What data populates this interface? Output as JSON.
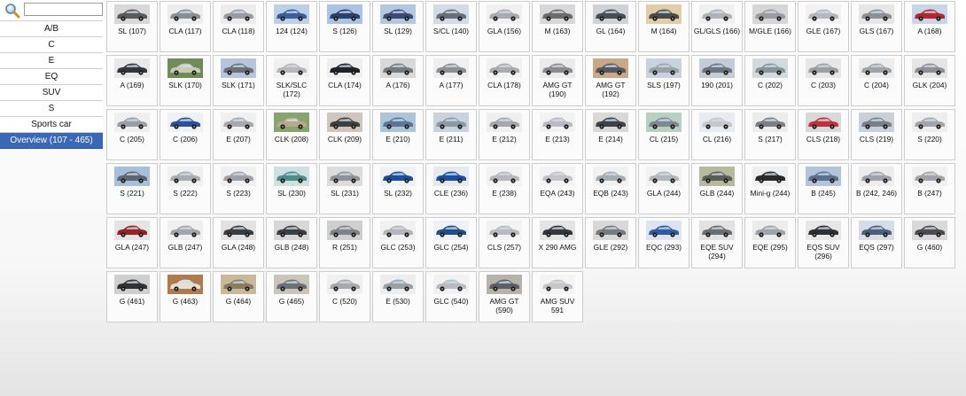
{
  "search": {
    "value": "",
    "placeholder": ""
  },
  "sidebar": {
    "items": [
      {
        "label": "A/B"
      },
      {
        "label": "C"
      },
      {
        "label": "E"
      },
      {
        "label": "EQ"
      },
      {
        "label": "SUV"
      },
      {
        "label": "S"
      },
      {
        "label": "Sports car"
      },
      {
        "label": "Overview (107 - 465)",
        "active": true
      }
    ]
  },
  "models": [
    {
      "label": "SL (107)",
      "color": "#5a5a5a",
      "bg": "#d8d8d8"
    },
    {
      "label": "CLA (117)",
      "color": "#8a8d92",
      "bg": "#ececec"
    },
    {
      "label": "CLA (118)",
      "color": "#9a9ca0",
      "bg": "#ececec"
    },
    {
      "label": "124 (124)",
      "color": "#3b5d9c",
      "bg": "#bcd0e8"
    },
    {
      "label": "S (126)",
      "color": "#2c3e6e",
      "bg": "#a9c3e0"
    },
    {
      "label": "SL (129)",
      "color": "#3a4a78",
      "bg": "#b3c7df"
    },
    {
      "label": "S/CL (140)",
      "color": "#6a6f78",
      "bg": "#d3dbe6"
    },
    {
      "label": "GLA (156)",
      "color": "#a8aaae",
      "bg": "#f0f0f0"
    },
    {
      "label": "M (163)",
      "color": "#6b6b6b",
      "bg": "#d8d8d8"
    },
    {
      "label": "GL (164)",
      "color": "#4a4e54",
      "bg": "#cfd2d6"
    },
    {
      "label": "M (164)",
      "color": "#4b4b4b",
      "bg": "#e0cfa6"
    },
    {
      "label": "GL/GLS (166)",
      "color": "#b0b2b5",
      "bg": "#f0f0f0"
    },
    {
      "label": "M/GLE (166)",
      "color": "#9a9c9f",
      "bg": "#d6d6d6"
    },
    {
      "label": "GLE (167)",
      "color": "#b5b7ba",
      "bg": "#f2f2f2"
    },
    {
      "label": "GLS (167)",
      "color": "#8e9094",
      "bg": "#e6e6e6"
    },
    {
      "label": "A (168)",
      "color": "#b5262a",
      "bg": "#c9d6ea"
    },
    {
      "label": "A (169)",
      "color": "#33363a",
      "bg": "#e9e9e9"
    },
    {
      "label": "SLK (170)",
      "color": "#c9c9b6",
      "bg": "#6f8b5a"
    },
    {
      "label": "SLK (171)",
      "color": "#6a6f7a",
      "bg": "#b7c4dd"
    },
    {
      "label": "SLK/SLC (172)",
      "color": "#b6b8bb",
      "bg": "#f1f1f1"
    },
    {
      "label": "CLA (174)",
      "color": "#1f2226",
      "bg": "#efefef"
    },
    {
      "label": "A (176)",
      "color": "#777a7e",
      "bg": "#d9d9d9"
    },
    {
      "label": "A (177)",
      "color": "#8c8f93",
      "bg": "#efefef"
    },
    {
      "label": "CLA (178)",
      "color": "#a9abaf",
      "bg": "#f2f2f2"
    },
    {
      "label": "AMG GT (190)",
      "color": "#8a8c8f",
      "bg": "#ebebeb"
    },
    {
      "label": "AMG GT (192)",
      "color": "#55595e",
      "bg": "#c7a98a"
    },
    {
      "label": "SLS (197)",
      "color": "#9aa0a8",
      "bg": "#c9d3df"
    },
    {
      "label": "190 (201)",
      "color": "#6d7480",
      "bg": "#c4ccd8"
    },
    {
      "label": "C (202)",
      "color": "#87959a",
      "bg": "#d2dade"
    },
    {
      "label": "C (203)",
      "color": "#9b9fa4",
      "bg": "#e7e7e7"
    },
    {
      "label": "C (204)",
      "color": "#a1a3a7",
      "bg": "#ededed"
    },
    {
      "label": "GLK (204)",
      "color": "#8c8f94",
      "bg": "#e5e5e5"
    },
    {
      "label": "C (205)",
      "color": "#9a9da1",
      "bg": "#efefef"
    },
    {
      "label": "C (206)",
      "color": "#2a5298",
      "bg": "#eef1f6"
    },
    {
      "label": "E (207)",
      "color": "#a7a9ad",
      "bg": "#f0f0f0"
    },
    {
      "label": "CLK (208)",
      "color": "#b7aa8a",
      "bg": "#88a46e"
    },
    {
      "label": "CLK (209)",
      "color": "#3f3f3f",
      "bg": "#cfc6bd"
    },
    {
      "label": "E (210)",
      "color": "#5d7694",
      "bg": "#aec4db"
    },
    {
      "label": "E (211)",
      "color": "#8d98a3",
      "bg": "#c8d3de"
    },
    {
      "label": "E (212)",
      "color": "#a5a7ab",
      "bg": "#efefef"
    },
    {
      "label": "E (213)",
      "color": "#b9bbbe",
      "bg": "#f2f2f2"
    },
    {
      "label": "E (214)",
      "color": "#3e4246",
      "bg": "#d9d9d9"
    },
    {
      "label": "CL (215)",
      "color": "#7e8890",
      "bg": "#b7d0c2"
    },
    {
      "label": "CL (216)",
      "color": "#c6c8cb",
      "bg": "#e7ecf2"
    },
    {
      "label": "S (217)",
      "color": "#7c7f83",
      "bg": "#ececec"
    },
    {
      "label": "CLS (218)",
      "color": "#c1313a",
      "bg": "#d9d9d9"
    },
    {
      "label": "CLS (219)",
      "color": "#7a7f88",
      "bg": "#c9d0d9"
    },
    {
      "label": "S (220)",
      "color": "#a3a5a9",
      "bg": "#eeeeee"
    },
    {
      "label": "S (221)",
      "color": "#5e6670",
      "bg": "#a8bfdc"
    },
    {
      "label": "S (222)",
      "color": "#a9abaf",
      "bg": "#f0f0f0"
    },
    {
      "label": "S (223)",
      "color": "#9fa1a5",
      "bg": "#f0f0f0"
    },
    {
      "label": "SL (230)",
      "color": "#4e8c8a",
      "bg": "#cfe0e0"
    },
    {
      "label": "SL (231)",
      "color": "#8f9296",
      "bg": "#dcdcdc"
    },
    {
      "label": "SL (232)",
      "color": "#1e4e93",
      "bg": "#eef1f6"
    },
    {
      "label": "CLE (236)",
      "color": "#1d4d9c",
      "bg": "#e6e9ef"
    },
    {
      "label": "E (238)",
      "color": "#b6b8bb",
      "bg": "#f3f3f3"
    },
    {
      "label": "EQA (243)",
      "color": "#c2c4c7",
      "bg": "#f3f3f3"
    },
    {
      "label": "EQB (243)",
      "color": "#a9acaf",
      "bg": "#f1f1f1"
    },
    {
      "label": "GLA (244)",
      "color": "#b4b6b9",
      "bg": "#f2f2f2"
    },
    {
      "label": "GLB (244)",
      "color": "#5a5e55",
      "bg": "#b7b99f"
    },
    {
      "label": "Mini-g (244)",
      "color": "#2b2b2b",
      "bg": "#efefef"
    },
    {
      "label": "B (245)",
      "color": "#5a6e8e",
      "bg": "#b3c3d9"
    },
    {
      "label": "B (242, 246)",
      "color": "#9ea1a5",
      "bg": "#ececec"
    },
    {
      "label": "B (247)",
      "color": "#a2a4a8",
      "bg": "#f1f1f1"
    },
    {
      "label": "GLA (247)",
      "color": "#9b1f26",
      "bg": "#e4e4e4"
    },
    {
      "label": "GLB (247)",
      "color": "#a2a5a9",
      "bg": "#efefef"
    },
    {
      "label": "GLA (248)",
      "color": "#3a3d40",
      "bg": "#e2e2e2"
    },
    {
      "label": "GLB (248)",
      "color": "#3c3f44",
      "bg": "#d7d7d7"
    },
    {
      "label": "R (251)",
      "color": "#7f8287",
      "bg": "#cfcfcf"
    },
    {
      "label": "GLC (253)",
      "color": "#b3b5b8",
      "bg": "#f1f1f1"
    },
    {
      "label": "GLC (254)",
      "color": "#1d4f8e",
      "bg": "#eef1f6"
    },
    {
      "label": "CLS (257)",
      "color": "#b8babd",
      "bg": "#f3f3f3"
    },
    {
      "label": "X 290 AMG",
      "color": "#33363b",
      "bg": "#e4e4e4"
    },
    {
      "label": "GLE (292)",
      "color": "#777b80",
      "bg": "#d8d8d8"
    },
    {
      "label": "EQC (293)",
      "color": "#2f5aa6",
      "bg": "#dde4ef"
    },
    {
      "label": "EQE SUV (294)",
      "color": "#6a6e73",
      "bg": "#e2e2e2"
    },
    {
      "label": "EQE (295)",
      "color": "#9fa2a6",
      "bg": "#ececec"
    },
    {
      "label": "EQS SUV (296)",
      "color": "#2d3035",
      "bg": "#e7e7e7"
    },
    {
      "label": "EQS (297)",
      "color": "#4d5e7a",
      "bg": "#d7dde6"
    },
    {
      "label": "G (460)",
      "color": "#4a4c50",
      "bg": "#d9d9d9"
    },
    {
      "label": "G (461)",
      "color": "#2f3134",
      "bg": "#cfcfcf"
    },
    {
      "label": "G (463)",
      "color": "#e3e0d6",
      "bg": "#b07a4f"
    },
    {
      "label": "G (464)",
      "color": "#8c7b5e",
      "bg": "#c9b99a"
    },
    {
      "label": "G (465)",
      "color": "#6d7076",
      "bg": "#c9c5bb"
    },
    {
      "label": "C (520)",
      "color": "#a7a9ad",
      "bg": "#f0f0f0"
    },
    {
      "label": "E (530)",
      "color": "#9c9fa3",
      "bg": "#ededed"
    },
    {
      "label": "GLC (540)",
      "color": "#b9bbbe",
      "bg": "#f2f2f2"
    },
    {
      "label": "AMG GT (590)",
      "color": "#5c6066",
      "bg": "#b7b3ab"
    },
    {
      "label": "AMG SUV 591",
      "color": "#c4c6c9",
      "bg": "#f4f4f4"
    }
  ]
}
